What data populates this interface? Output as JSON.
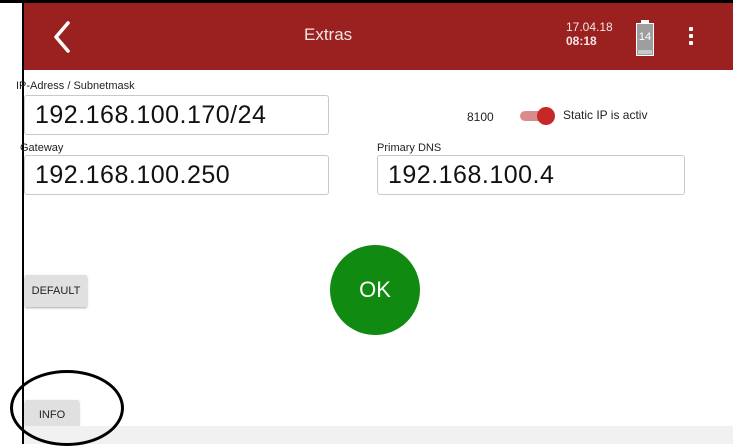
{
  "header": {
    "title": "Extras",
    "date": "17.04.18",
    "time": "08:18",
    "battery_level": "14",
    "back_icon": "chevron-left-icon",
    "menu_icon": "more-vert-icon",
    "color": "#9b2020"
  },
  "network": {
    "ip_label": "IP-Adress / Subnetmask",
    "ip_value": "192.168.100.170/24",
    "port": "8100",
    "static_ip_label": "Static IP is activ",
    "static_ip_on": true,
    "gateway_label": "Gateway",
    "gateway_value": "192.168.100.250",
    "dns_label": "Primary DNS",
    "dns_value": "192.168.100.4"
  },
  "buttons": {
    "default_label": "DEFAULT",
    "ok_label": "OK",
    "info_label": "INFO"
  },
  "colors": {
    "ok_green": "#108a10",
    "toggle_red": "#c62828"
  }
}
